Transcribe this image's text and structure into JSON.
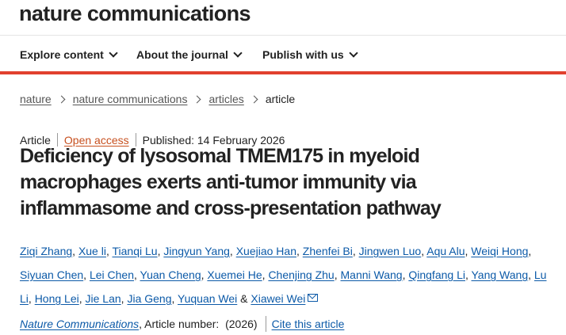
{
  "header": {
    "brand": "nature communications"
  },
  "nav": {
    "items": [
      {
        "label": "Explore content"
      },
      {
        "label": "About the journal"
      },
      {
        "label": "Publish with us"
      }
    ]
  },
  "breadcrumb": {
    "items": [
      "nature",
      "nature communications",
      "articles"
    ],
    "current": "article"
  },
  "article": {
    "type": "Article",
    "access": "Open access",
    "published": "Published: 14 February 2026",
    "title": "Deficiency of lysosomal TMEM175 in myeloid macrophages exerts anti-tumor immunity via inflammasome and cross-presentation pathway",
    "authors": [
      "Ziqi Zhang",
      "Xue li",
      "Tianqi Lu",
      "Jingyun Yang",
      "Xuejiao Han",
      "Zhenfei Bi",
      "Jingwen Luo",
      "Aqu Alu",
      "Weiqi Hong",
      "Siyuan Chen",
      "Lei Chen",
      "Yuan Cheng",
      "Xuemei He",
      "Chenjing Zhu",
      "Manni Wang",
      "Qingfang Li",
      "Yang Wang",
      "Lu Li",
      "Hong Lei",
      "Jie Lan",
      "Jia Geng",
      "Yuquan Wei",
      "Xiawei Wei"
    ],
    "author_sep": ",",
    "author_and": "&",
    "journal": "Nature Communications",
    "article_number": ", Article number:  (2026)",
    "cite_label": "Cite this article"
  },
  "icons": {
    "corresponding_author": "mail-icon",
    "nav_dropdown": "chevron-down-icon",
    "breadcrumb_sep": "chevron-right-icon"
  },
  "colors": {
    "accent_bar": "#e1402e",
    "link": "#0c5aa8",
    "open_access": "#c7501f"
  }
}
